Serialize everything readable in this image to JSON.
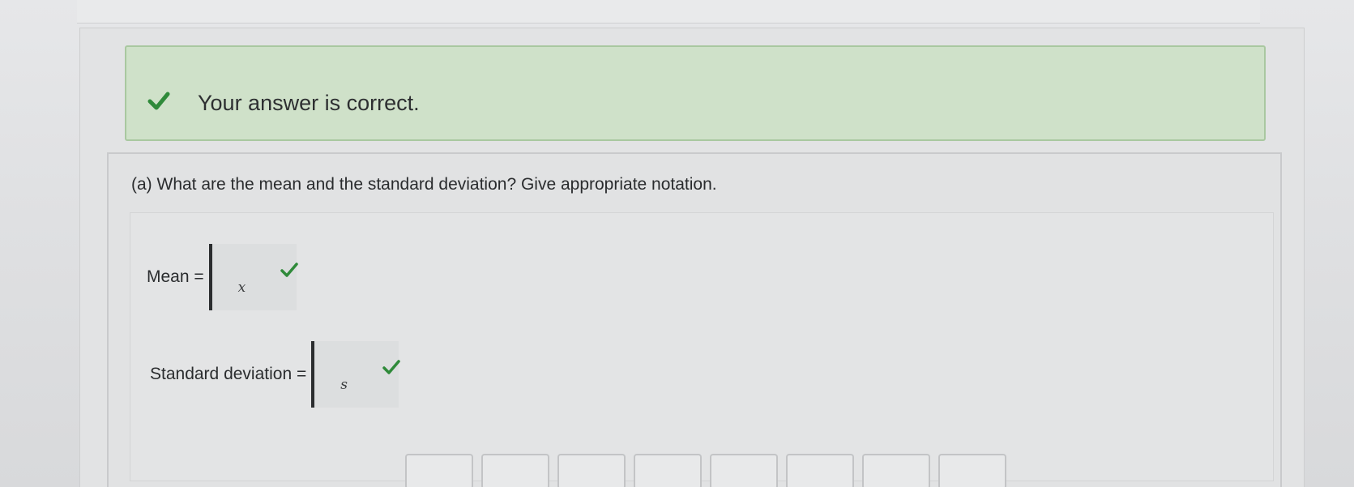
{
  "feedback": {
    "message": "Your answer is correct.",
    "icon": "check-icon",
    "color": "#2f8a3a"
  },
  "question": {
    "prompt": "(a) What are the mean and the standard deviation? Give appropriate notation."
  },
  "answers": [
    {
      "label": "Mean =",
      "value": "x",
      "status_icon": "check-icon"
    },
    {
      "label": "Standard deviation =",
      "value": "s",
      "status_icon": "check-icon"
    }
  ],
  "colors": {
    "success_background": "#cfe1c9",
    "success_border": "#a9c8a0",
    "check": "#2f8a3a"
  }
}
